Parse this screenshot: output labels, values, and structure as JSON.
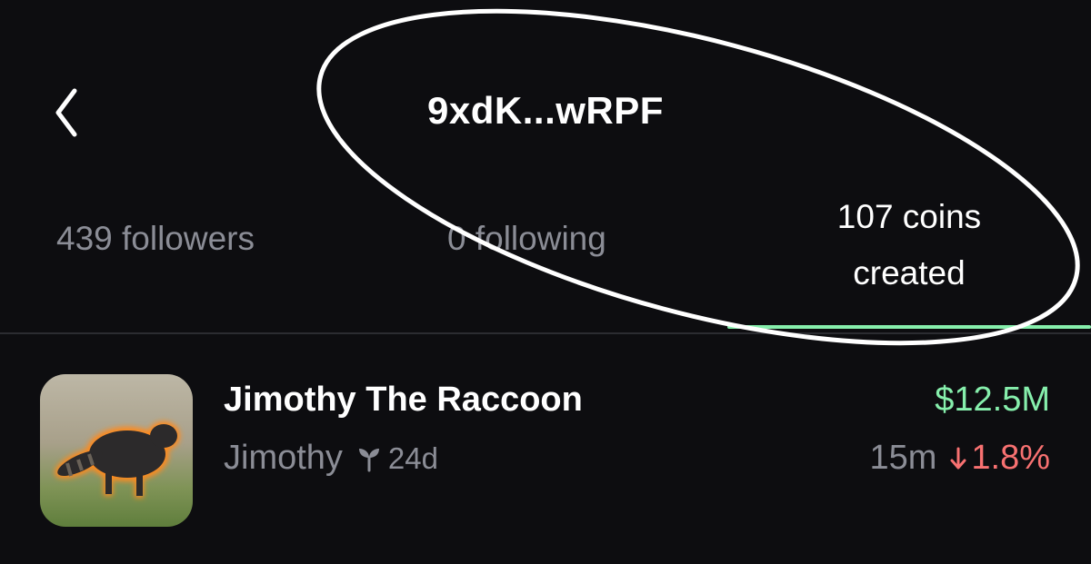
{
  "header": {
    "title": "9xdK...wRPF"
  },
  "tabs": {
    "followers": "439 followers",
    "following": "0 following",
    "coins_line1": "107 coins",
    "coins_line2": "created"
  },
  "coins": [
    {
      "name": "Jimothy The Raccoon",
      "creator": "Jimothy",
      "age": "24d",
      "market_cap": "$12.5M",
      "interval": "15m",
      "change": "1.8%",
      "change_direction": "down"
    }
  ],
  "colors": {
    "background": "#0d0d10",
    "muted_text": "#8b8d96",
    "positive": "#86efac",
    "negative": "#f87171",
    "annotation": "#ffffff"
  },
  "icons": {
    "back": "chevron-left-icon",
    "sprout": "sprout-icon",
    "down": "arrow-down-icon"
  }
}
